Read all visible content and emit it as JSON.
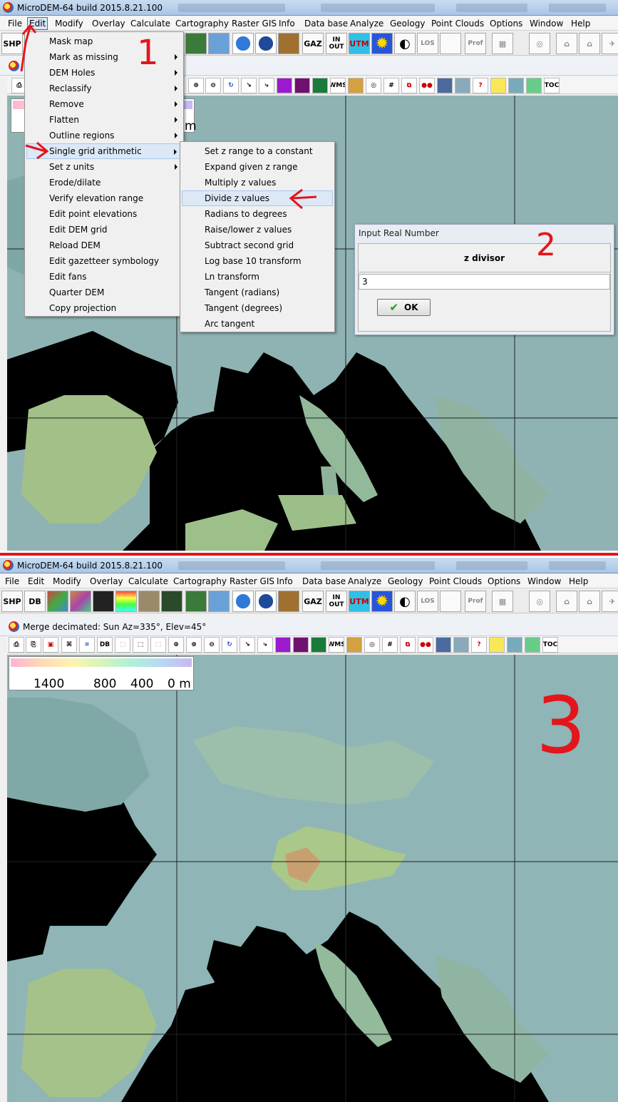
{
  "window": {
    "title": "MicroDEM-64 build 2015.8.21.100"
  },
  "menubar": [
    {
      "label": "File"
    },
    {
      "label": "Edit"
    },
    {
      "label": "Modify"
    },
    {
      "label": "Overlay"
    },
    {
      "label": "Calculate"
    },
    {
      "label": "Cartography"
    },
    {
      "label": "Raster GIS"
    },
    {
      "label": "Info"
    },
    {
      "label": "Data base"
    },
    {
      "label": "Analyze"
    },
    {
      "label": "Geology"
    },
    {
      "label": "Point Clouds"
    },
    {
      "label": "Options"
    },
    {
      "label": "Window"
    },
    {
      "label": "Help"
    }
  ],
  "toolbar": {
    "shp": "SHP",
    "db": "DB",
    "gaz": "GAZ",
    "in": "IN",
    "out": "OUT",
    "utm": "UTM",
    "los": "LOS",
    "prof": "Prof"
  },
  "map_toolbar": {
    "wms": "WMS",
    "db": "DB",
    "toc": "TOC"
  },
  "edit_menu": {
    "items": [
      {
        "label": "Mask map",
        "submenu": false
      },
      {
        "label": "Mark as missing",
        "submenu": true
      },
      {
        "label": "DEM Holes",
        "submenu": true
      },
      {
        "label": "Reclassify",
        "submenu": true
      },
      {
        "label": "Remove",
        "submenu": true
      },
      {
        "label": "Flatten",
        "submenu": true
      },
      {
        "label": "Outline regions",
        "submenu": true
      },
      {
        "label": "Single grid arithmetic",
        "submenu": true,
        "highlighted": true
      },
      {
        "label": "Set z units",
        "submenu": true
      },
      {
        "label": "Erode/dilate",
        "submenu": false
      },
      {
        "label": "Verify elevation range",
        "submenu": false
      },
      {
        "label": "Edit point elevations",
        "submenu": false
      },
      {
        "label": "Edit DEM grid",
        "submenu": false
      },
      {
        "label": "Reload DEM",
        "submenu": false
      },
      {
        "label": "Edit gazetteer symbology",
        "submenu": false
      },
      {
        "label": "Edit fans",
        "submenu": false
      },
      {
        "label": "Quarter DEM",
        "submenu": false
      },
      {
        "label": "Copy projection",
        "submenu": false
      }
    ]
  },
  "arith_menu": {
    "items": [
      {
        "label": "Set z range to a constant"
      },
      {
        "label": "Expand given z range"
      },
      {
        "label": "Multiply z values"
      },
      {
        "label": "Divide z values",
        "highlighted": true
      },
      {
        "label": "Radians to degrees"
      },
      {
        "label": "Raise/lower z values"
      },
      {
        "label": "Subtract second grid"
      },
      {
        "label": "Log base 10 transform"
      },
      {
        "label": "Ln transform"
      },
      {
        "label": "Tangent (radians)"
      },
      {
        "label": "Tangent (degrees)"
      },
      {
        "label": "Arc tangent"
      }
    ]
  },
  "dialog": {
    "title": "Input Real Number",
    "label": "z divisor",
    "value": "3",
    "ok_label": "OK"
  },
  "bottom_window": {
    "title": "Merge decimated: Sun Az=335°, Elev=45°"
  },
  "legend": {
    "ticks": [
      "1400",
      "800",
      "400",
      "0 m"
    ],
    "partial_unit": "m"
  },
  "annotations": {
    "step1": "1",
    "step2": "2",
    "step3": "3"
  },
  "colors": {
    "annotation_red": "#e3161b",
    "menu_highlight": "#dce8f6",
    "map_sea": "#000000"
  }
}
